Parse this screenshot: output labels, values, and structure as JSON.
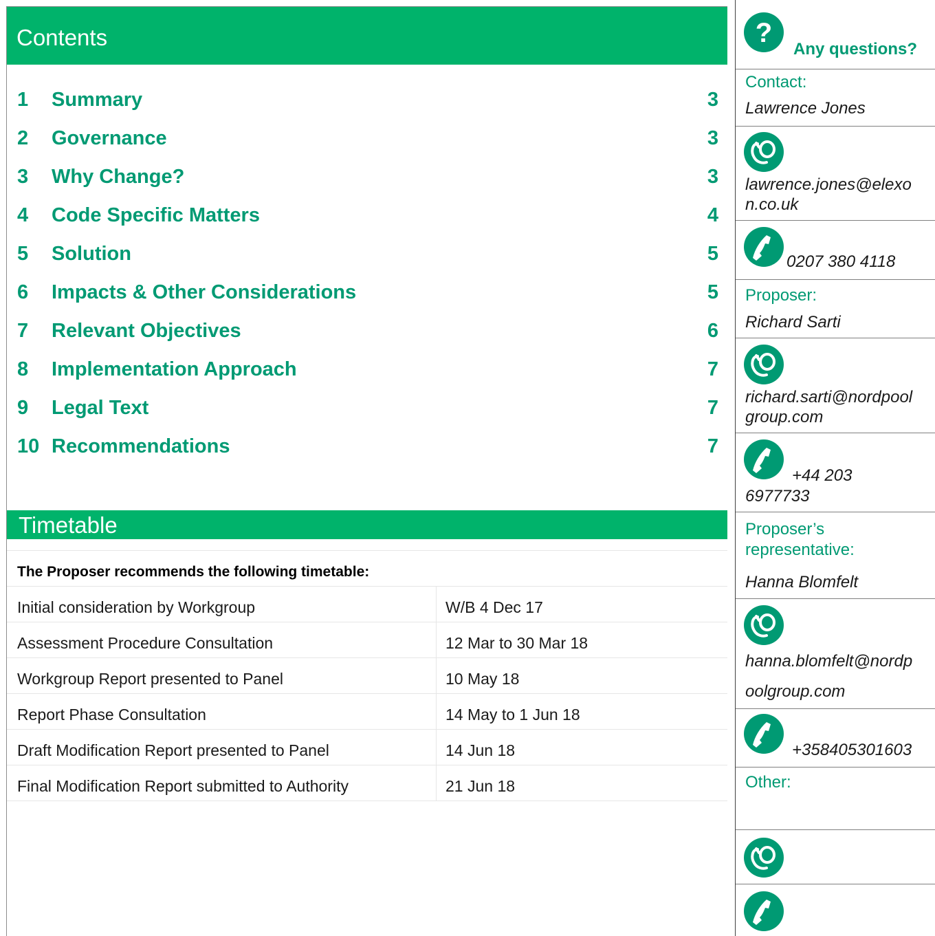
{
  "contents": {
    "heading": "Contents",
    "items": [
      {
        "num": "1",
        "title": "Summary",
        "page": "3"
      },
      {
        "num": "2",
        "title": "Governance",
        "page": "3"
      },
      {
        "num": "3",
        "title": "Why Change?",
        "page": "3"
      },
      {
        "num": "4",
        "title": "Code Specific Matters",
        "page": "4"
      },
      {
        "num": "5",
        "title": "Solution",
        "page": "5"
      },
      {
        "num": "6",
        "title": "Impacts & Other Considerations",
        "page": "5"
      },
      {
        "num": "7",
        "title": "Relevant Objectives",
        "page": "6"
      },
      {
        "num": "8",
        "title": "Implementation Approach",
        "page": "7"
      },
      {
        "num": "9",
        "title": "Legal Text",
        "page": "7"
      },
      {
        "num": "10",
        "title": "Recommendations",
        "page": "7"
      }
    ]
  },
  "timetable": {
    "heading": "Timetable",
    "intro": "The Proposer recommends the following timetable:",
    "rows": [
      {
        "label": "Initial consideration by Workgroup",
        "date": "W/B 4 Dec 17"
      },
      {
        "label": "Assessment Procedure Consultation",
        "date": "12 Mar to 30 Mar 18"
      },
      {
        "label": "Workgroup Report presented to Panel",
        "date": "10 May 18"
      },
      {
        "label": "Report Phase Consultation",
        "date": "14 May to 1 Jun 18"
      },
      {
        "label": "Draft Modification Report presented to Panel",
        "date": "14 Jun 18"
      },
      {
        "label": "Final Modification Report submitted to Authority",
        "date": "21 Jun 18"
      }
    ]
  },
  "sidebar": {
    "heading": "Any questions?",
    "contact_label": "Contact:",
    "contact_name": "Lawrence Jones",
    "contact_email_1": "lawrence.jones@elexo",
    "contact_email_2": "n.co.uk",
    "contact_phone": "0207 380 4118",
    "proposer_label": "Proposer:",
    "proposer_name": "Richard Sarti",
    "proposer_email_1": "richard.sarti@nordpool",
    "proposer_email_2": "group.com",
    "proposer_phone_1": "+44 203",
    "proposer_phone_2": "6977733",
    "rep_label_1": "Proposer’s",
    "rep_label_2": "representative:",
    "rep_name": "Hanna Blomfelt",
    "rep_email_1": "hanna.blomfelt@nordp",
    "rep_email_2": "oolgroup.com",
    "rep_phone": "+358405301603",
    "other_label": "Other:"
  },
  "colors": {
    "accent": "#00b36b",
    "accent_text": "#009a73",
    "icon": "#009a73"
  }
}
